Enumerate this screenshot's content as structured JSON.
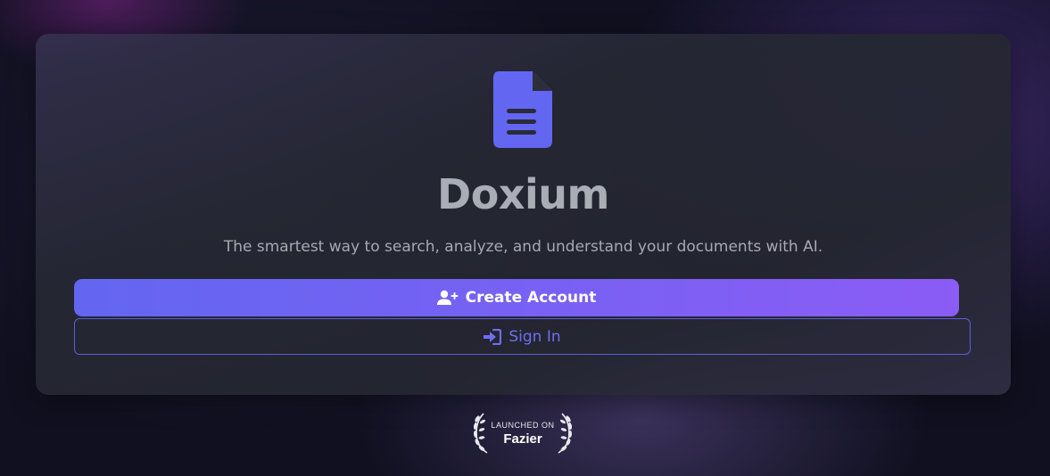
{
  "app": {
    "name": "Doxium",
    "tagline": "The smartest way to search, analyze, and understand your documents with AI."
  },
  "actions": {
    "create_account_label": "Create Account",
    "sign_in_label": "Sign In"
  },
  "badge": {
    "small_text": "LAUNCHED ON",
    "big_text": "Fazier"
  },
  "icons": {
    "logo": "document-icon",
    "create_account": "user-plus-icon",
    "sign_in": "sign-in-icon",
    "badge_decor": "laurel-icon"
  },
  "colors": {
    "accent": "#6366f1",
    "accent_end": "#8b5cf6",
    "background": "#101020",
    "card": "#262834",
    "title_text": "#a9adb6",
    "tagline_text": "#a6a9b4"
  }
}
